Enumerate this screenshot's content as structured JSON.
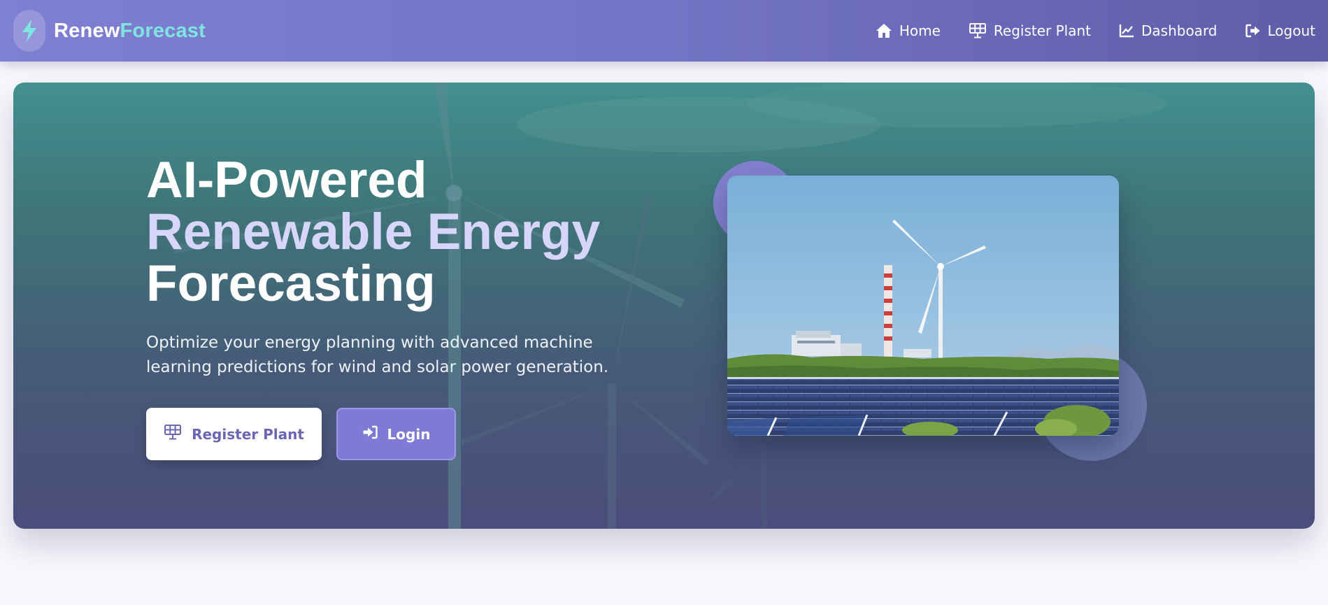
{
  "brand": {
    "name_part1": "Renew",
    "name_part2": "Forecast",
    "icon": "lightning-bolt-icon"
  },
  "nav": {
    "home": {
      "label": "Home",
      "icon": "home-icon"
    },
    "register": {
      "label": "Register Plant",
      "icon": "solar-panel-icon"
    },
    "dashboard": {
      "label": "Dashboard",
      "icon": "line-chart-icon"
    },
    "logout": {
      "label": "Logout",
      "icon": "sign-out-icon"
    }
  },
  "hero": {
    "title_line1": "AI-Powered",
    "title_line2": "Renewable Energy",
    "title_line3": "Forecasting",
    "subtitle": "Optimize your energy planning with advanced machine learning predictions for wind and solar power generation.",
    "primary_button": {
      "label": "Register Plant",
      "icon": "solar-panel-icon"
    },
    "secondary_button": {
      "label": "Login",
      "icon": "sign-in-icon"
    }
  },
  "colors": {
    "nav_gradient_start": "#7f7fd3",
    "nav_gradient_end": "#5f5da8",
    "brand_accent": "#7ee6df",
    "title_highlight": "#d7d6fa",
    "primary_button_text": "#6a66b4",
    "secondary_button_bg": "#7e7ad6"
  }
}
